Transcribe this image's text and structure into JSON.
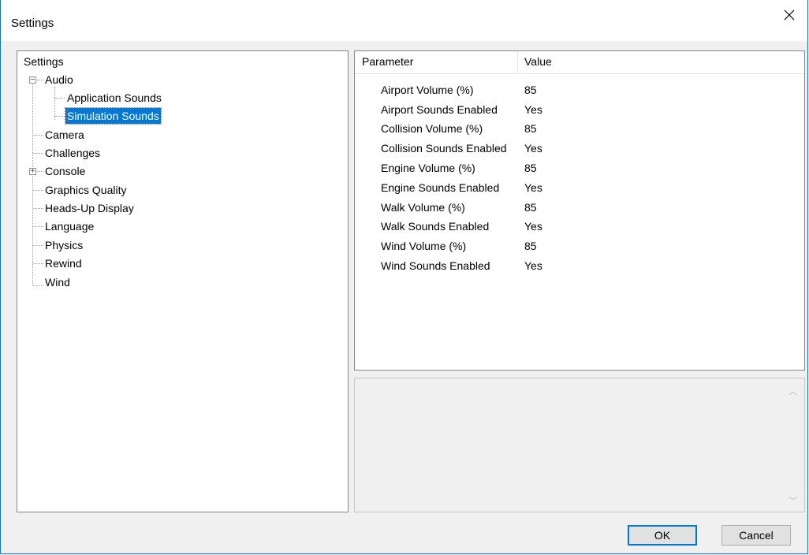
{
  "window": {
    "title": "Settings",
    "close_glyph": "✕"
  },
  "tree": {
    "root_label": "Settings",
    "items": [
      {
        "label": "Audio",
        "expander": "−"
      },
      {
        "label": "Application Sounds"
      },
      {
        "label": "Simulation Sounds",
        "selected": true
      },
      {
        "label": "Camera"
      },
      {
        "label": "Challenges"
      },
      {
        "label": "Console",
        "expander": "+"
      },
      {
        "label": "Graphics Quality"
      },
      {
        "label": "Heads-Up Display"
      },
      {
        "label": "Language"
      },
      {
        "label": "Physics"
      },
      {
        "label": "Rewind"
      },
      {
        "label": "Wind"
      }
    ]
  },
  "properties": {
    "headers": {
      "parameter": "Parameter",
      "value": "Value"
    },
    "rows": [
      {
        "name": "Airport Volume (%)",
        "value": "85"
      },
      {
        "name": "Airport Sounds Enabled",
        "value": "Yes"
      },
      {
        "name": "Collision Volume (%)",
        "value": "85"
      },
      {
        "name": "Collision Sounds Enabled",
        "value": "Yes"
      },
      {
        "name": "Engine Volume (%)",
        "value": "85"
      },
      {
        "name": "Engine Sounds Enabled",
        "value": "Yes"
      },
      {
        "name": "Walk Volume (%)",
        "value": "85"
      },
      {
        "name": "Walk Sounds Enabled",
        "value": "Yes"
      },
      {
        "name": "Wind Volume (%)",
        "value": "85"
      },
      {
        "name": "Wind Sounds Enabled",
        "value": "Yes"
      }
    ]
  },
  "description": {
    "scroll_up_glyph": "︿",
    "scroll_down_glyph": "﹀"
  },
  "buttons": {
    "ok": "OK",
    "cancel": "Cancel"
  },
  "colors": {
    "selection": "#0078d7",
    "window_border": "#1a6fc7"
  }
}
